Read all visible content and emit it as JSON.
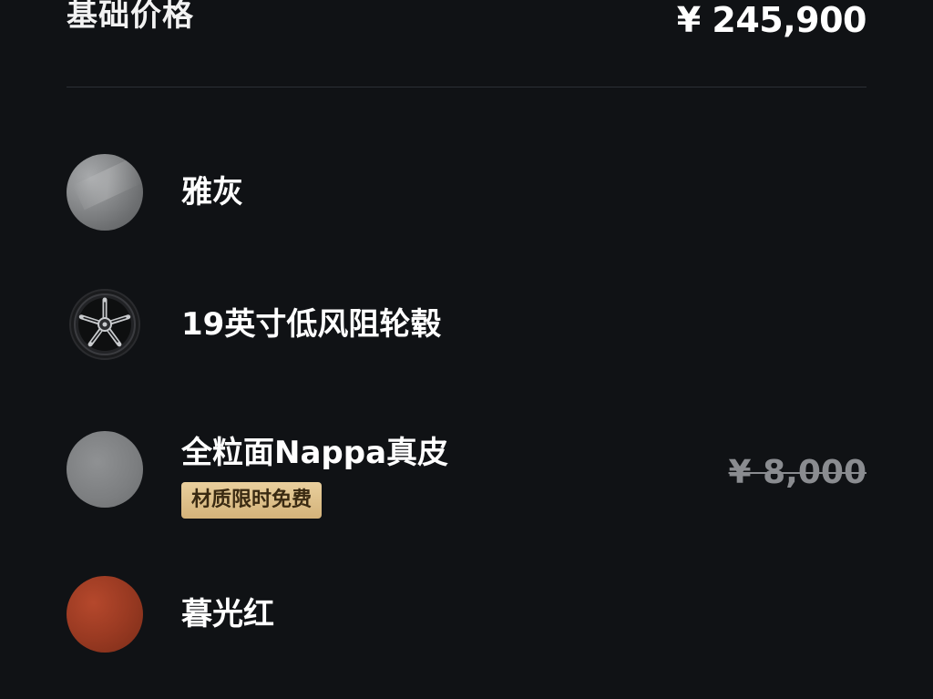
{
  "base": {
    "label": "基础价格",
    "price": "¥ 245,900"
  },
  "options": [
    {
      "name": "雅灰",
      "swatch": "gray-paint-swatch",
      "color": "#8b8d8f"
    },
    {
      "name": "19英寸低风阻轮毂",
      "swatch": "wheel-icon"
    },
    {
      "name": "全粒面Nappa真皮",
      "swatch": "leather-swatch",
      "color": "#7c7e80",
      "badge": "材质限时免费",
      "old_price": "¥ 8,000"
    },
    {
      "name": "暮光红",
      "swatch": "red-paint-swatch",
      "color": "#9a3a22"
    }
  ],
  "colors": {
    "background": "#101215",
    "badge_gold": "#dfc08b",
    "strikethrough_gray": "#8a8c90"
  }
}
